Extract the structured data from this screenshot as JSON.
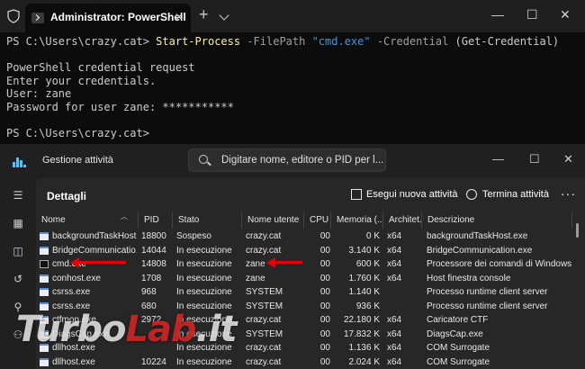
{
  "terminal": {
    "tab_title": "Administrator: PowerShell",
    "tab_close": "✕",
    "new_tab": "+",
    "lines": {
      "l1_prompt": "PS C:\\Users\\crazy.cat> ",
      "l1_cmd": "Start-Process",
      "l1_p1": " -FilePath ",
      "l1_str": "\"cmd.exe\"",
      "l1_p2": " -Credential ",
      "l1_rest": "(Get-Credential)",
      "l3": "PowerShell credential request",
      "l4": "Enter your credentials.",
      "l5": "User: zane",
      "l6": "Password for user zane: ***********",
      "l8": "PS C:\\Users\\crazy.cat>"
    }
  },
  "taskmgr": {
    "app_title": "Gestione attività",
    "search_placeholder": "Digitare nome, editore o PID per l...",
    "page_title": "Dettagli",
    "run_task_label": "Esegui nuova attività",
    "end_task_label": "Termina attività",
    "more_label": "···",
    "columns": [
      "Nome",
      "PID",
      "Stato",
      "Nome utente",
      "CPU",
      "Memoria (...",
      "Architet...",
      "Descrizione"
    ],
    "rows": [
      {
        "name": "backgroundTaskHost...",
        "pid": "18800",
        "status": "Sospeso",
        "user": "crazy.cat",
        "cpu": "00",
        "mem": "0 K",
        "arch": "x64",
        "desc": "backgroundTaskHost.exe"
      },
      {
        "name": "BridgeCommunicatio...",
        "pid": "14044",
        "status": "In esecuzione",
        "user": "crazy.cat",
        "cpu": "00",
        "mem": "3.140 K",
        "arch": "x64",
        "desc": "BridgeCommunication.exe"
      },
      {
        "name": "cmd.exe",
        "pid": "14808",
        "status": "In esecuzione",
        "user": "zane",
        "cpu": "00",
        "mem": "600 K",
        "arch": "x64",
        "desc": "Processore dei comandi di Windows"
      },
      {
        "name": "conhost.exe",
        "pid": "1708",
        "status": "In esecuzione",
        "user": "zane",
        "cpu": "00",
        "mem": "1.760 K",
        "arch": "x64",
        "desc": "Host finestra console"
      },
      {
        "name": "csrss.exe",
        "pid": "968",
        "status": "In esecuzione",
        "user": "SYSTEM",
        "cpu": "00",
        "mem": "1.140 K",
        "arch": "",
        "desc": "Processo runtime client server"
      },
      {
        "name": "csrss.exe",
        "pid": "680",
        "status": "In esecuzione",
        "user": "SYSTEM",
        "cpu": "00",
        "mem": "936 K",
        "arch": "",
        "desc": "Processo runtime client server"
      },
      {
        "name": "ctfmon.exe",
        "pid": "2972",
        "status": "In esecuzione",
        "user": "crazy.cat",
        "cpu": "00",
        "mem": "22.180 K",
        "arch": "x64",
        "desc": "Caricatore CTF"
      },
      {
        "name": "DiagsCap.exe",
        "pid": "",
        "status": "In esecuzione",
        "user": "SYSTEM",
        "cpu": "00",
        "mem": "17.832 K",
        "arch": "x64",
        "desc": "DiagsCap.exe"
      },
      {
        "name": "dllhost.exe",
        "pid": "",
        "status": "In esecuzione",
        "user": "crazy.cat",
        "cpu": "00",
        "mem": "1.136 K",
        "arch": "x64",
        "desc": "COM Surrogate"
      },
      {
        "name": "dllhost.exe",
        "pid": "10224",
        "status": "In esecuzione",
        "user": "crazy.cat",
        "cpu": "00",
        "mem": "2.024 K",
        "arch": "x64",
        "desc": "COM Surrogate"
      }
    ]
  },
  "watermark": {
    "part1": "Turbo",
    "part2": "Lab",
    "part3": ".it"
  },
  "colors": {
    "accent": "#4cc2ff",
    "arrow": "#e3000b",
    "ps_command": "#f9f1a5",
    "ps_string": "#3a96dd"
  }
}
